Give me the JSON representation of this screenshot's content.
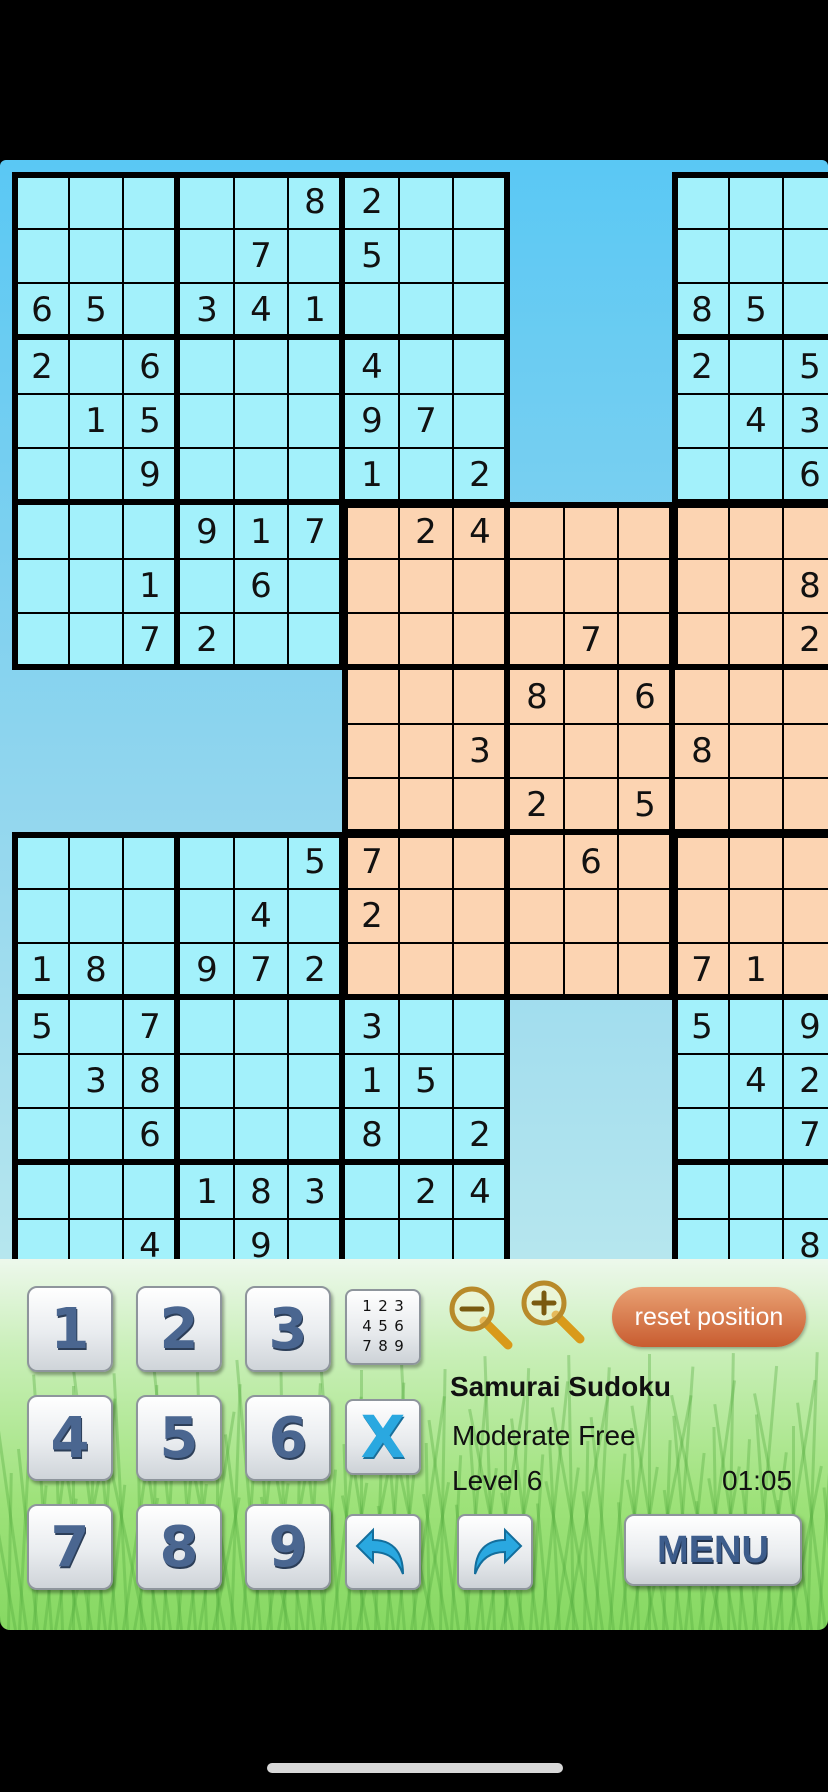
{
  "game": {
    "title": "Samurai Sudoku",
    "mode": "Moderate Free",
    "level": "Level 6",
    "timer": "01:05"
  },
  "buttons": {
    "reset_label": "reset position",
    "menu_label": "MENU",
    "erase_label": "X",
    "pencil_digits": [
      "1",
      "2",
      "3",
      "4",
      "5",
      "6",
      "7",
      "8",
      "9"
    ],
    "number_keys": [
      "1",
      "2",
      "3",
      "4",
      "5",
      "6",
      "7",
      "8",
      "9"
    ]
  },
  "icons": {
    "zoom_out": "zoom-out-icon",
    "zoom_in": "zoom-in-icon",
    "undo": "undo-arrow-icon",
    "redo": "redo-arrow-icon"
  },
  "colors": {
    "outer_grid_cell": "#a3f1fb",
    "center_grid_cell": "#fcd4b2",
    "key_digit": "#4a6690",
    "erase_x": "#2aa8e0",
    "arrow": "#2aa8e0",
    "reset_button": "#d2703f"
  },
  "board": {
    "rows": [
      "     82   ·      ",
      "    7 5    ·     "
    ],
    "grids": {
      "top_left": [
        ".....82..",
        "....7.5..",
        "65.341...",
        "2.6...4..",
        ".15...97.",
        "..9...1.2",
        "...917.24",
        "..1.6....",
        "..72....."
      ],
      "top_right_visible": [
        "...",
        "...",
        "85.",
        "2.5",
        ".43",
        "..6",
        "...",
        "..8",
        "..2"
      ],
      "center": [
        ".24......",
        ".........",
        "....7...2",
        "...8.6...",
        "..3...8..",
        "...2.5...",
        "7...6....",
        "2........",
        "......71."
      ],
      "bottom_left": [
        ".....57..",
        "....4.2..",
        "18.972...",
        "5.7...3..",
        ".38...15.",
        "..6...8.2",
        "...183.24",
        "..4.9....",
        "........."
      ],
      "bottom_right_visible": [
        "...",
        "...",
        "71.",
        "5.9",
        ".42",
        "..7",
        "...",
        "..8",
        "..."
      ]
    }
  }
}
